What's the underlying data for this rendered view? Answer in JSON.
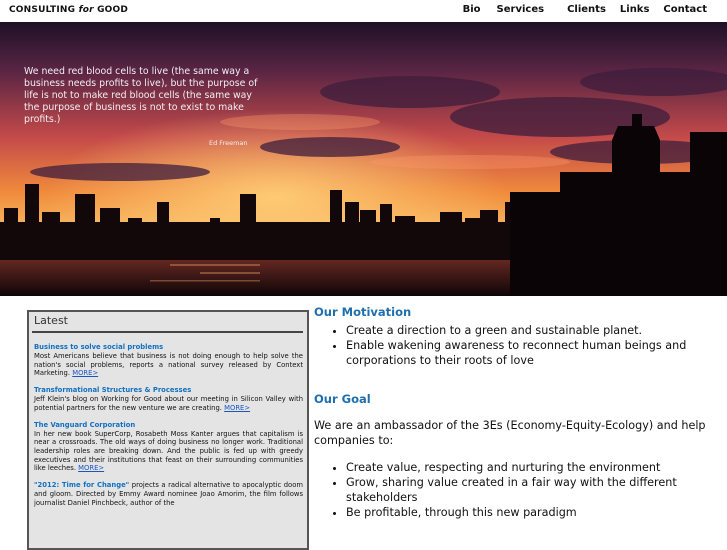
{
  "site": {
    "logo_text": "CONSULTING",
    "logo_for": "for",
    "logo_good": "GOOD"
  },
  "nav": [
    "Bio",
    "Services",
    "Clients",
    "Links",
    "Contact"
  ],
  "hero": {
    "quote": "We need red blood cells to live (the same way a business needs profits to live), but the purpose of life is not to make red blood cells (the same way the purpose of business is not to exist to make profits.)",
    "author": "Ed Freeman"
  },
  "latest": {
    "heading": "Latest",
    "items": [
      {
        "title": "Business to solve social problems",
        "body": "Most Americans believe that business is not doing enough to help solve the nation's social problems, reports a national survey released by Context Marketing.",
        "more": "MORE>"
      },
      {
        "title": "Transformational Structures & Processes",
        "body": "Jeff Klein's blog on Working for Good about our meeting in Silicon Valley with potential partners for the new venture we are creating.",
        "more": "MORE>"
      },
      {
        "title": "The Vanguard Corporation",
        "body": "In her new book SuperCorp, Rosabeth Moss Kanter argues that capitalism is near a crossroads. The old ways of doing business no longer work. Traditional leadership roles are breaking down. And the public is fed up with greedy executives and their institutions that feast on their surrounding communities like leeches.",
        "more": "MORE>"
      },
      {
        "title": "\"2012: Time for Change\"",
        "body": "projects a radical alternative to apocalyptic doom and gloom. Directed by Emmy Award nominee Joao Amorim, the film follows journalist Daniel Pinchbeck, author of the",
        "more": ""
      }
    ]
  },
  "main": {
    "motivation_title": "Our Motivation",
    "motivation_items": [
      "Create a direction to a green and sustainable planet.",
      "Enable wakening awareness to reconnect human beings and corporations to their roots of love"
    ],
    "goal_title": "Our Goal",
    "goal_text": "We are an ambassador of the 3Es (Economy-Equity-Ecology) and help companies to:",
    "goal_items": [
      "Create value, respecting and nurturing the environment",
      "Grow, sharing value created in a fair way with the different stakeholders",
      "Be profitable, through this new paradigm"
    ]
  }
}
